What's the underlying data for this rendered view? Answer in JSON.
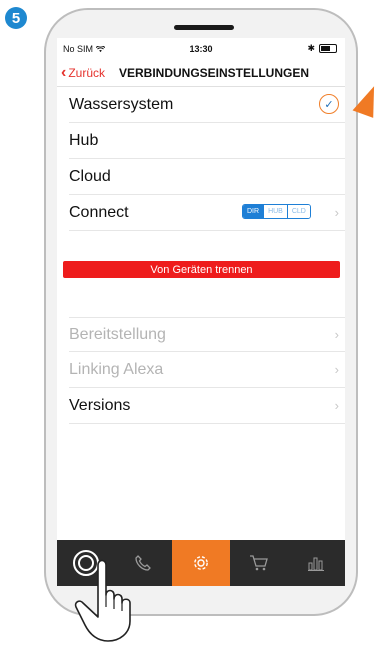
{
  "step_number": "5",
  "status_bar": {
    "carrier": "No SIM",
    "time": "13:30"
  },
  "nav": {
    "back_label": "Zurück",
    "title": "VERBINDUNGSEINSTELLUNGEN"
  },
  "settings": {
    "rows": [
      {
        "label": "Wassersystem",
        "state": "checked"
      },
      {
        "label": "Hub"
      },
      {
        "label": "Cloud"
      },
      {
        "label": "Connect"
      }
    ],
    "connect_segments": [
      "DIR",
      "HUB",
      "CLD"
    ],
    "connect_selected": "DIR",
    "disconnect_button": "Von Geräten trennen",
    "more_rows": [
      {
        "label": "Bereitstellung",
        "enabled": false
      },
      {
        "label": "Linking Alexa",
        "enabled": false
      },
      {
        "label": "Versions",
        "enabled": true
      }
    ]
  },
  "tabbar": {
    "tabs": [
      {
        "icon": "home-control-icon"
      },
      {
        "icon": "phone-icon"
      },
      {
        "icon": "gear-icon",
        "active": true
      },
      {
        "icon": "cart-icon"
      },
      {
        "icon": "bar-chart-icon"
      }
    ]
  },
  "colors": {
    "accent": "#f07a24",
    "danger": "#ee1c1c",
    "link_red": "#e5322d",
    "segment_blue": "#1e7fd6",
    "badge_blue": "#1e88d0"
  }
}
